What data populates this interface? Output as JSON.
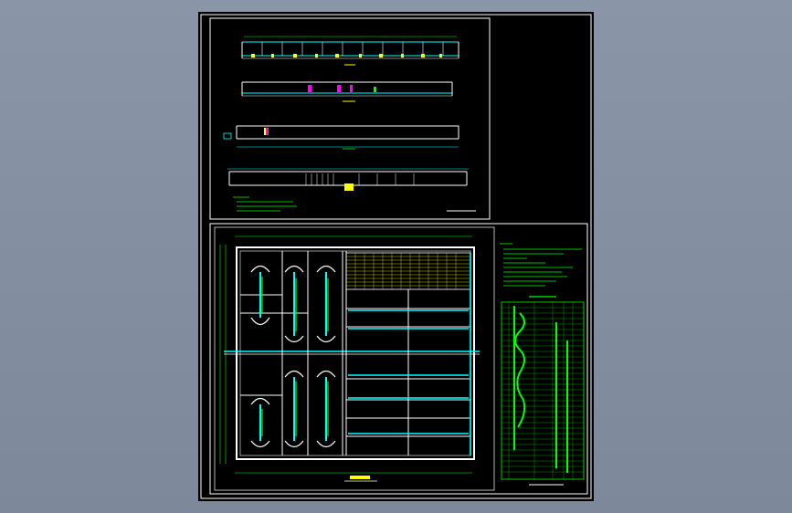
{
  "viewer": {
    "background_color": "#8591a4",
    "sheet_color": "#000000"
  },
  "drawing": {
    "colors": {
      "frame": "#ffffff",
      "green": "#00ff00",
      "cyan": "#00ffff",
      "yellow": "#ffff00",
      "magenta": "#ff00ff",
      "white": "#ffffff"
    }
  }
}
